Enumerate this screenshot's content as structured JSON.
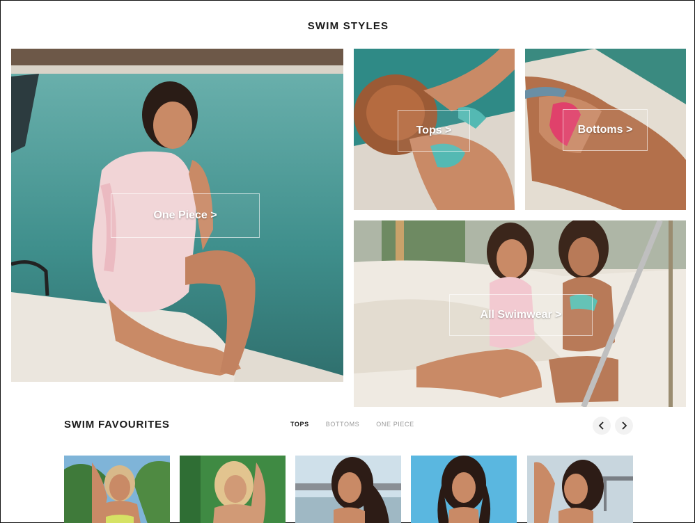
{
  "page": {
    "title": "SWIM STYLES"
  },
  "tiles": {
    "one_piece": {
      "label": "One Piece >"
    },
    "tops": {
      "label": "Tops >"
    },
    "bottoms": {
      "label": "Bottoms >"
    },
    "all_swimwear": {
      "label": "All Swimwear >"
    }
  },
  "favourites": {
    "title": "SWIM FAVOURITES",
    "tabs": [
      {
        "label": "TOPS",
        "active": true
      },
      {
        "label": "BOTTOMS",
        "active": false
      },
      {
        "label": "ONE PIECE",
        "active": false
      }
    ],
    "prev_icon": "chevron-left-icon",
    "next_icon": "chevron-right-icon"
  },
  "colors": {
    "text": "#1a1a1a",
    "muted_tab": "#9a9a9a",
    "pool": "#3f8f8c",
    "skin": "#c98a66"
  }
}
